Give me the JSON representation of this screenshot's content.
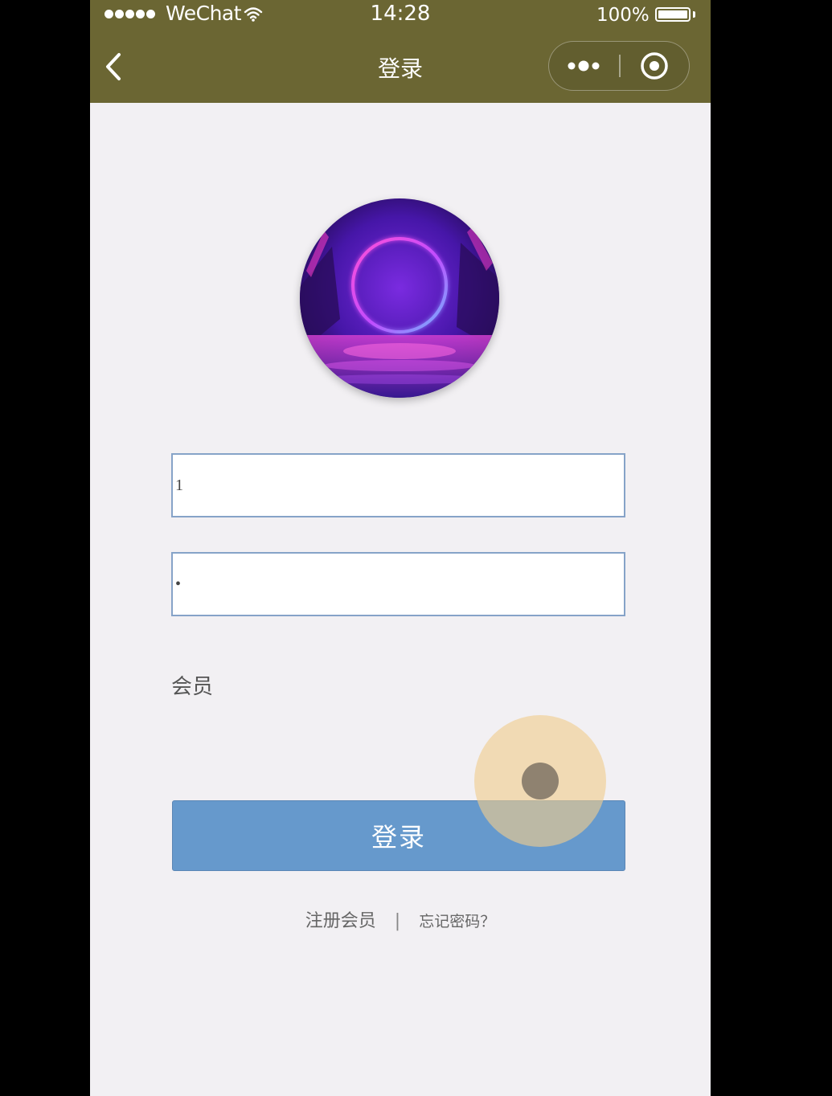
{
  "status_bar": {
    "carrier": "WeChat",
    "time": "14:28",
    "battery_percent": "100%",
    "battery_level": 1.0,
    "signal_dots": 5
  },
  "nav_bar": {
    "title": "登录",
    "back_icon": "chevron-left-icon",
    "more_icon": "more-dots-icon",
    "close_icon": "record-target-icon"
  },
  "avatar": {
    "icon": "neon-ring-avatar"
  },
  "form": {
    "username_value": "1",
    "password_value": "•",
    "role_label": "会员",
    "login_button_label": "登录"
  },
  "footer": {
    "register_link": "注册会员",
    "separator": "|",
    "forgot_link": "忘记密码？"
  },
  "colors": {
    "nav_background": "#6b6633",
    "page_background": "#f2f0f3",
    "button_background": "#6699cc",
    "input_border": "#86a3c8"
  }
}
